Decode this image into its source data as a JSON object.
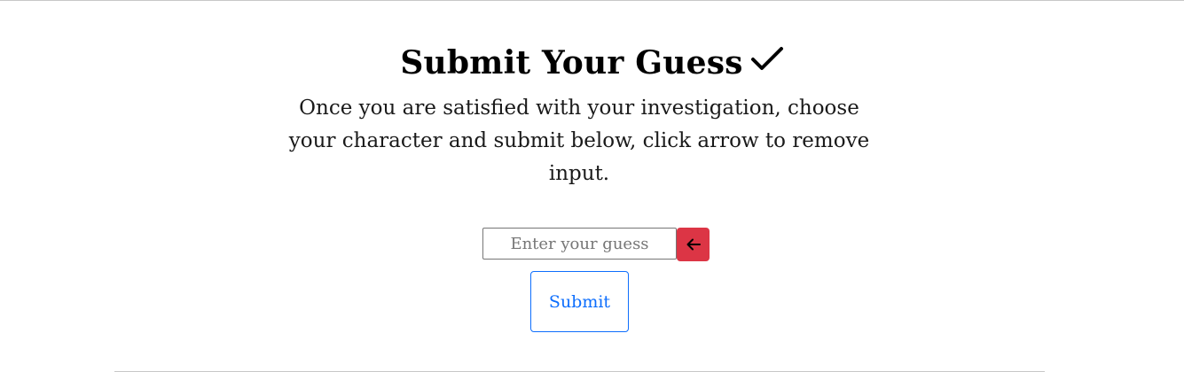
{
  "section": {
    "title": "Submit Your Guess",
    "title_icon": "checkmark-icon",
    "description": "Once you are satisfied with your investigation, choose your character and submit below, click arrow to remove input."
  },
  "guess_form": {
    "input_value": "",
    "input_placeholder": "Enter your guess",
    "clear_icon": "arrow-left-icon",
    "submit_label": "Submit"
  },
  "colors": {
    "danger": "#dc3545",
    "primary": "#0d6efd"
  }
}
